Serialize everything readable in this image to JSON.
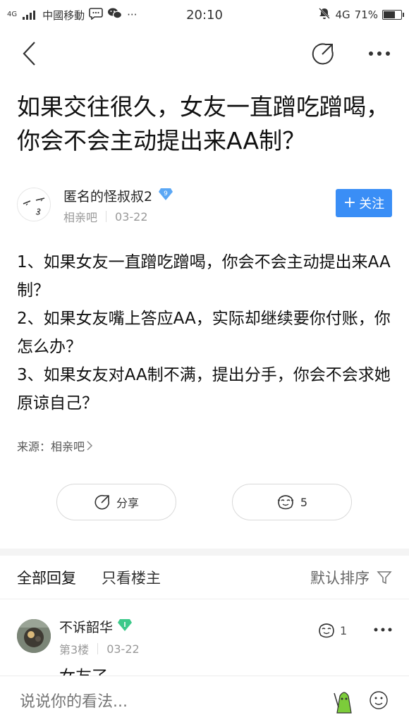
{
  "status_bar": {
    "network_top": "4G",
    "carrier": "中國移動",
    "more_dots": "···",
    "time": "20:10",
    "network_type": "4G",
    "battery_percent": "71%",
    "battery_level": 0.71
  },
  "post": {
    "title": "如果交往很久，女友一直蹭吃蹭喝，你会不会主动提出来AA制？",
    "author": {
      "name": "匿名的怪叔叔2",
      "level": "9",
      "forum": "相亲吧",
      "date": "03-22",
      "follow_label": "关注",
      "follow_plus": "+"
    },
    "content": [
      "1、如果女友一直蹭吃蹭喝，你会不会主动提出来AA制？",
      "2、如果女友嘴上答应AA，实际却继续要你付账，你怎么办？",
      "3、如果女友对AA制不满，提出分手，你会不会求她原谅自己？"
    ],
    "source": "来源：相亲吧",
    "share_label": "分享",
    "like_count": "5"
  },
  "tabs": {
    "all": "全部回复",
    "owner": "只看楼主",
    "sort": "默认排序"
  },
  "reply": {
    "name": "不诉韶华",
    "floor": "第3楼",
    "date": "03-22",
    "like_count": "1",
    "text": "女友了，..."
  },
  "bottom_bar": {
    "placeholder": "说说你的看法..."
  },
  "colors": {
    "accent": "#3a8ef6",
    "gem_blue": "#5aa7f5",
    "gem_green": "#3cc98a"
  }
}
